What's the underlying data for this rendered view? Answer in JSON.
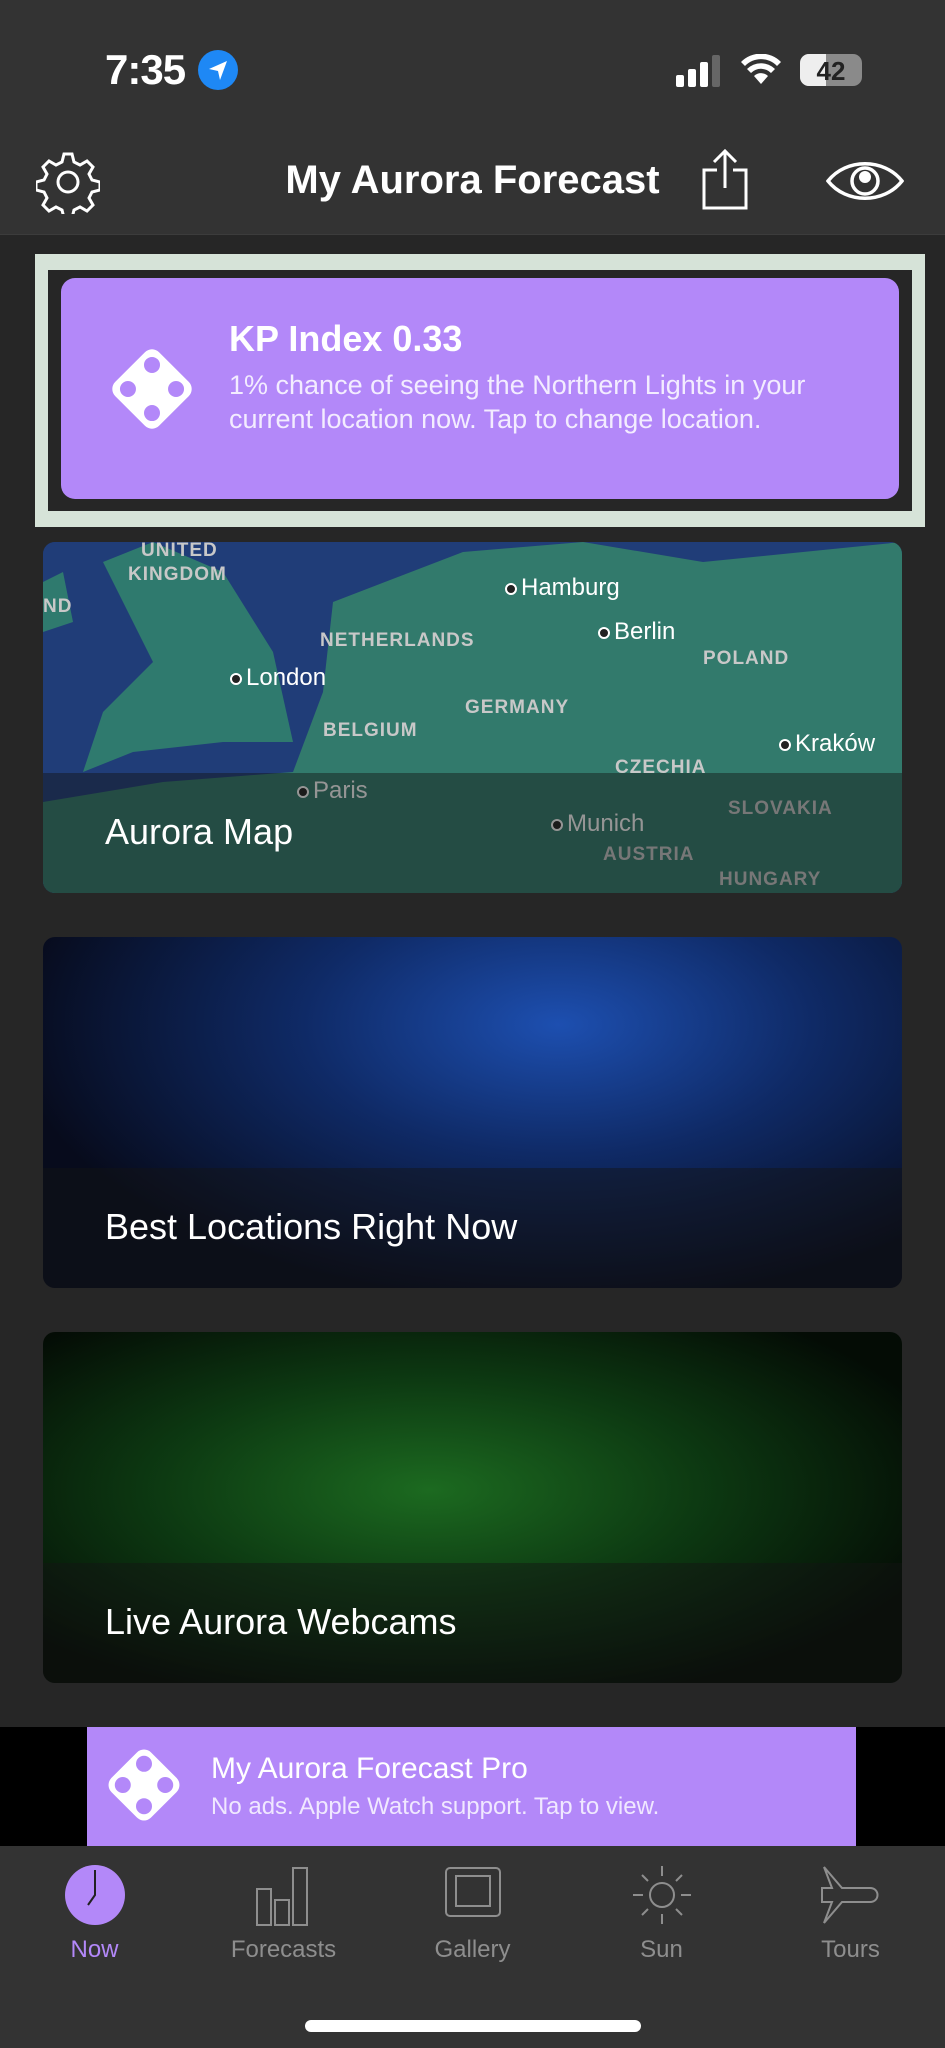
{
  "status": {
    "time": "7:35",
    "battery": "42"
  },
  "nav": {
    "title": "My Aurora Forecast"
  },
  "kp": {
    "title": "KP Index 0.33",
    "description": "1% chance of seeing the Northern Lights in your current location now. Tap to change location."
  },
  "cards": [
    {
      "label": "Aurora Map",
      "map_labels": [
        "UNITED",
        "KINGDOM",
        "ND",
        "NETHERLANDS",
        "BELGIUM",
        "GERMANY",
        "POLAND",
        "CZECHIA",
        "SLOVAKIA",
        "AUSTRIA",
        "HUNGARY"
      ],
      "cities": [
        "Hamburg",
        "Berlin",
        "London",
        "Kraków",
        "Paris",
        "Munich"
      ]
    },
    {
      "label": "Best Locations Right Now"
    },
    {
      "label": "Live Aurora Webcams"
    }
  ],
  "ad": {
    "title": "My Aurora Forecast Pro",
    "subtitle": "No ads. Apple Watch support. Tap to view."
  },
  "tabs": [
    {
      "label": "Now",
      "active": true
    },
    {
      "label": "Forecasts"
    },
    {
      "label": "Gallery"
    },
    {
      "label": "Sun"
    },
    {
      "label": "Tours"
    }
  ],
  "colors": {
    "accent": "#b388f9",
    "location": "#1e88f5"
  }
}
